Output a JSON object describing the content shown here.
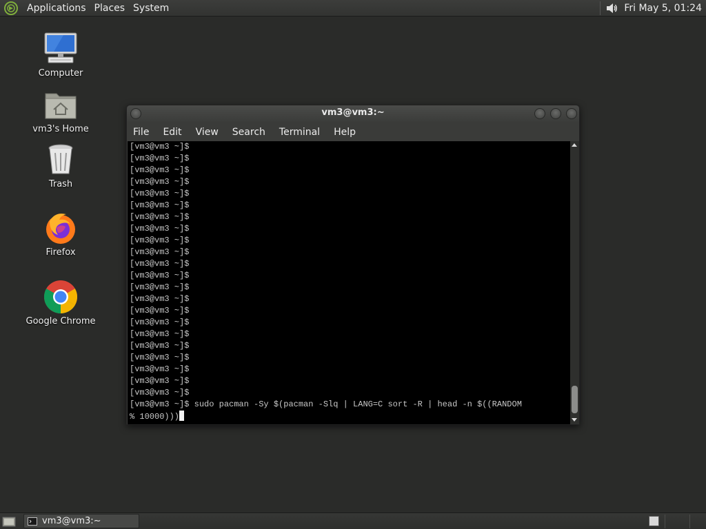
{
  "top_panel": {
    "menus": [
      "Applications",
      "Places",
      "System"
    ],
    "clock": "Fri May  5, 01:24"
  },
  "desktop_icons": [
    {
      "label": "Computer",
      "icon": "computer-icon"
    },
    {
      "label": "vm3's Home",
      "icon": "home-folder-icon"
    },
    {
      "label": "Trash",
      "icon": "trash-icon"
    },
    {
      "label": "Firefox",
      "icon": "firefox-icon"
    },
    {
      "label": "Google Chrome",
      "icon": "chrome-icon"
    }
  ],
  "terminal": {
    "title": "vm3@vm3:~",
    "menu": [
      "File",
      "Edit",
      "View",
      "Search",
      "Terminal",
      "Help"
    ],
    "prompt": "[vm3@vm3 ~]$",
    "empty_prompt_count": 22,
    "command_line_1": "[vm3@vm3 ~]$ sudo pacman -Sy $(pacman -Slq | LANG=C sort -R | head -n $((RANDOM",
    "command_line_2": "% 10000)))"
  },
  "bottom_panel": {
    "task_label": "vm3@vm3:~"
  },
  "colors": {
    "desktop": "#2a2b29",
    "panel": "#353634",
    "terminal_bg": "#000000",
    "terminal_fg": "#c8c8c8"
  }
}
